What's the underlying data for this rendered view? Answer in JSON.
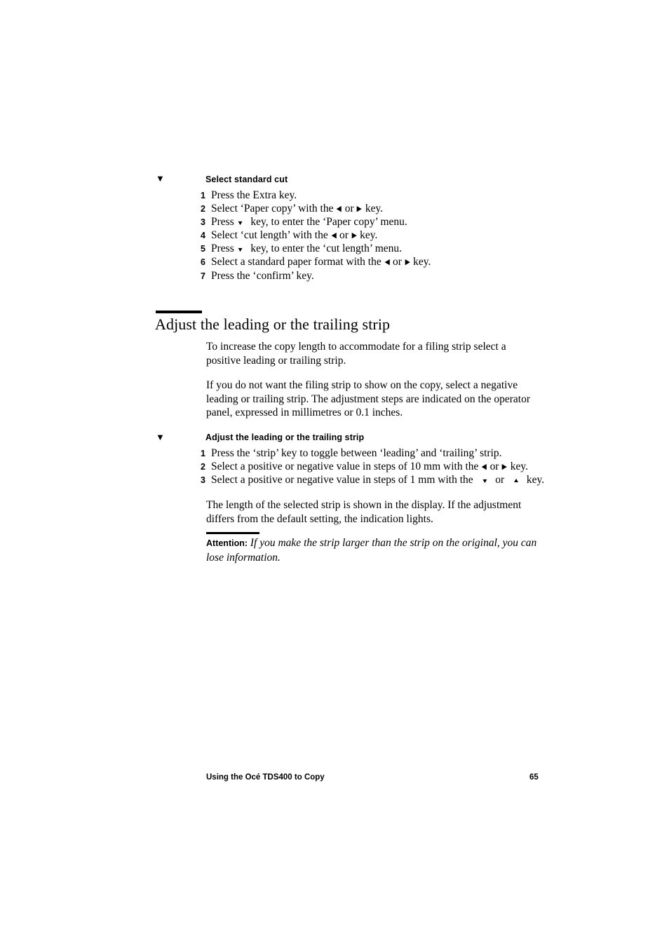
{
  "procedure1": {
    "marker": "▼",
    "title": "Select standard cut",
    "steps": [
      {
        "num": "1",
        "pre": "Press the Extra key.",
        "mid": "",
        "post": "",
        "arrows": []
      },
      {
        "num": "2",
        "pre": "Select ‘Paper copy’ with the",
        "mid": "or",
        "post": "key.",
        "arrows": [
          "left",
          "right"
        ]
      },
      {
        "num": "3",
        "pre": "Press",
        "mid": "",
        "post": "key, to enter the ‘Paper copy’ menu.",
        "arrows": [
          "down"
        ]
      },
      {
        "num": "4",
        "pre": "Select ‘cut length’ with the",
        "mid": "or",
        "post": "key.",
        "arrows": [
          "left",
          "right"
        ]
      },
      {
        "num": "5",
        "pre": "Press",
        "mid": "",
        "post": "key, to enter the ‘cut length’ menu.",
        "arrows": [
          "down"
        ]
      },
      {
        "num": "6",
        "pre": "Select a standard paper format with the",
        "mid": "or",
        "post": "key.",
        "arrows": [
          "left",
          "right"
        ]
      },
      {
        "num": "7",
        "pre": "Press the ‘confirm’ key.",
        "mid": "",
        "post": "",
        "arrows": []
      }
    ]
  },
  "heading": "Adjust the leading or the trailing strip",
  "paragraphs": {
    "p1": "To increase the copy length to accommodate for a filing strip select a positive leading or trailing strip.",
    "p2": "If you do not want the filing strip to show on the copy, select a negative leading or trailing strip. The adjustment steps are indicated on the operator panel, expressed in millimetres or 0.1 inches.",
    "p3": "The length of the selected strip is shown in the display. If the adjustment differs from the default setting, the indication lights."
  },
  "procedure2": {
    "marker": "▼",
    "title": "Adjust the leading or the trailing strip",
    "steps": [
      {
        "num": "1",
        "pre": "Press the ‘strip’ key to toggle between ‘leading’ and ‘trailing’ strip.",
        "mid": "",
        "post": "",
        "arrows": []
      },
      {
        "num": "2",
        "pre": "Select a positive or negative value in steps of 10 mm with the",
        "mid": "or",
        "post": "key.",
        "arrows": [
          "left",
          "right"
        ]
      },
      {
        "num": "3",
        "pre": "Select a positive or negative value in steps of 1 mm with the",
        "mid": "or",
        "post": "key.",
        "arrows": [
          "down",
          "up"
        ]
      }
    ]
  },
  "attention": {
    "label": "Attention:",
    "text": " If you make the strip larger than the strip on the original, you can lose information."
  },
  "footer": {
    "left": "Using the Océ TDS400 to Copy",
    "right": "65"
  }
}
